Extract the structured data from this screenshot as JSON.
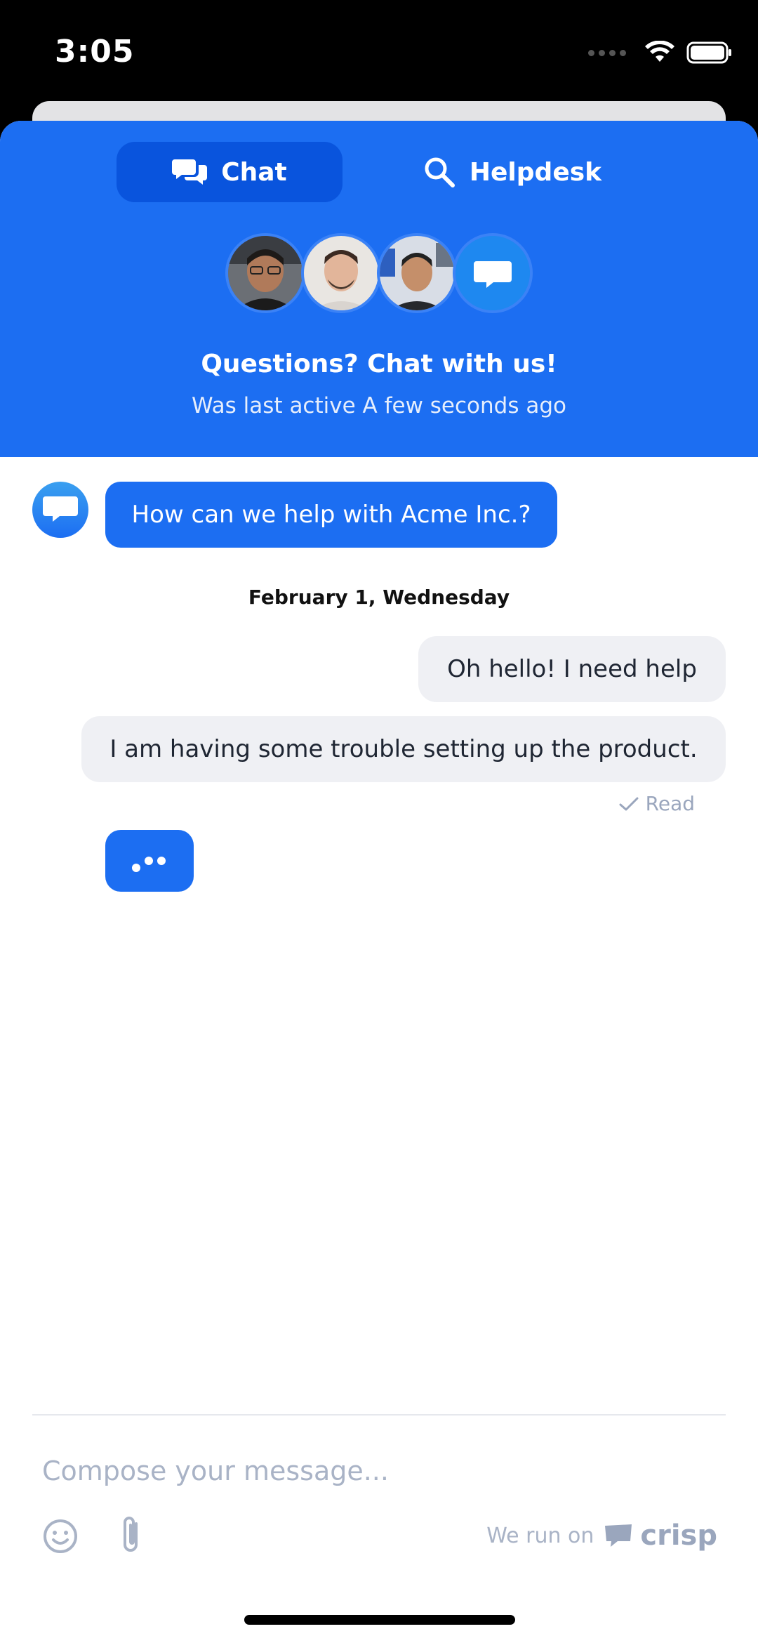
{
  "status_bar": {
    "time": "3:05",
    "icons": [
      "signal-dots-icon",
      "wifi-icon",
      "battery-icon"
    ]
  },
  "tabs": [
    {
      "label": "Chat",
      "icon": "chat-bubbles-icon",
      "active": true
    },
    {
      "label": "Helpdesk",
      "icon": "search-icon",
      "active": false
    }
  ],
  "header": {
    "title": "Questions? Chat with us!",
    "subtitle": "Was last active A few seconds ago"
  },
  "messages": {
    "operator_greeting": "How can we help with Acme Inc.?",
    "date_separator": "February 1, Wednesday",
    "user_1": "Oh hello! I need help",
    "user_2": "I am having some trouble setting up the product.",
    "read_status": "Read"
  },
  "composer": {
    "placeholder": "Compose your message..."
  },
  "footer": {
    "powered_by": "We run on",
    "brand": "crisp"
  },
  "colors": {
    "primary": "#1c6ef2",
    "active_tab": "#0954dd",
    "user_bubble": "#eff0f4",
    "muted_text": "#a9b3c6"
  }
}
